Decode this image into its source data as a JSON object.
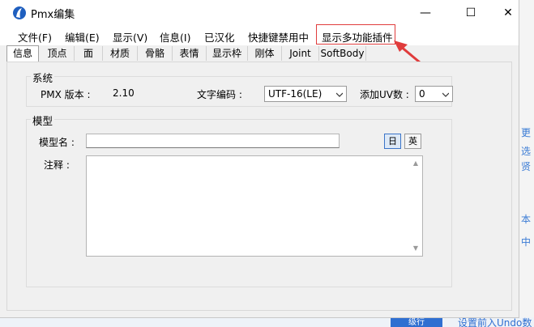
{
  "window": {
    "title": "Pmx编集",
    "minimize_glyph": "—",
    "maximize_glyph": "☐",
    "close_glyph": "✕"
  },
  "menu": [
    {
      "label": "文件(F)"
    },
    {
      "label": "编辑(E)"
    },
    {
      "label": "显示(V)"
    },
    {
      "label": "信息(I)"
    },
    {
      "label": "已汉化"
    },
    {
      "label": "快捷键禁用中"
    },
    {
      "label": "显示多功能插件"
    }
  ],
  "tabs": [
    {
      "label": "信息",
      "active": true
    },
    {
      "label": "顶点"
    },
    {
      "label": "面"
    },
    {
      "label": "材质"
    },
    {
      "label": "骨骼"
    },
    {
      "label": "表情"
    },
    {
      "label": "显示枠"
    },
    {
      "label": "刚体"
    },
    {
      "label": "Joint"
    },
    {
      "label": "SoftBody"
    }
  ],
  "system": {
    "group_label": "系统",
    "pmx_version_label": "PMX 版本 :",
    "pmx_version_value": "2.10",
    "encoding_label": "文字编码 :",
    "encoding_value": "UTF-16(LE)",
    "add_uv_label": "添加UV数 :",
    "add_uv_value": "0"
  },
  "model": {
    "group_label": "模型",
    "name_label": "模型名 :",
    "name_value": "",
    "comment_label": "注释 :",
    "comment_value": "",
    "lang_jp": "日",
    "lang_en": "英"
  },
  "background_app": {
    "side_glyphs": [
      "更",
      "选",
      "贤",
      "本",
      "中"
    ],
    "bottom_button": "级行",
    "bottom_text": "设置前入Undo数"
  },
  "colors": {
    "highlight_border": "#e03c3c",
    "accent_blue": "#2f6fd1"
  }
}
